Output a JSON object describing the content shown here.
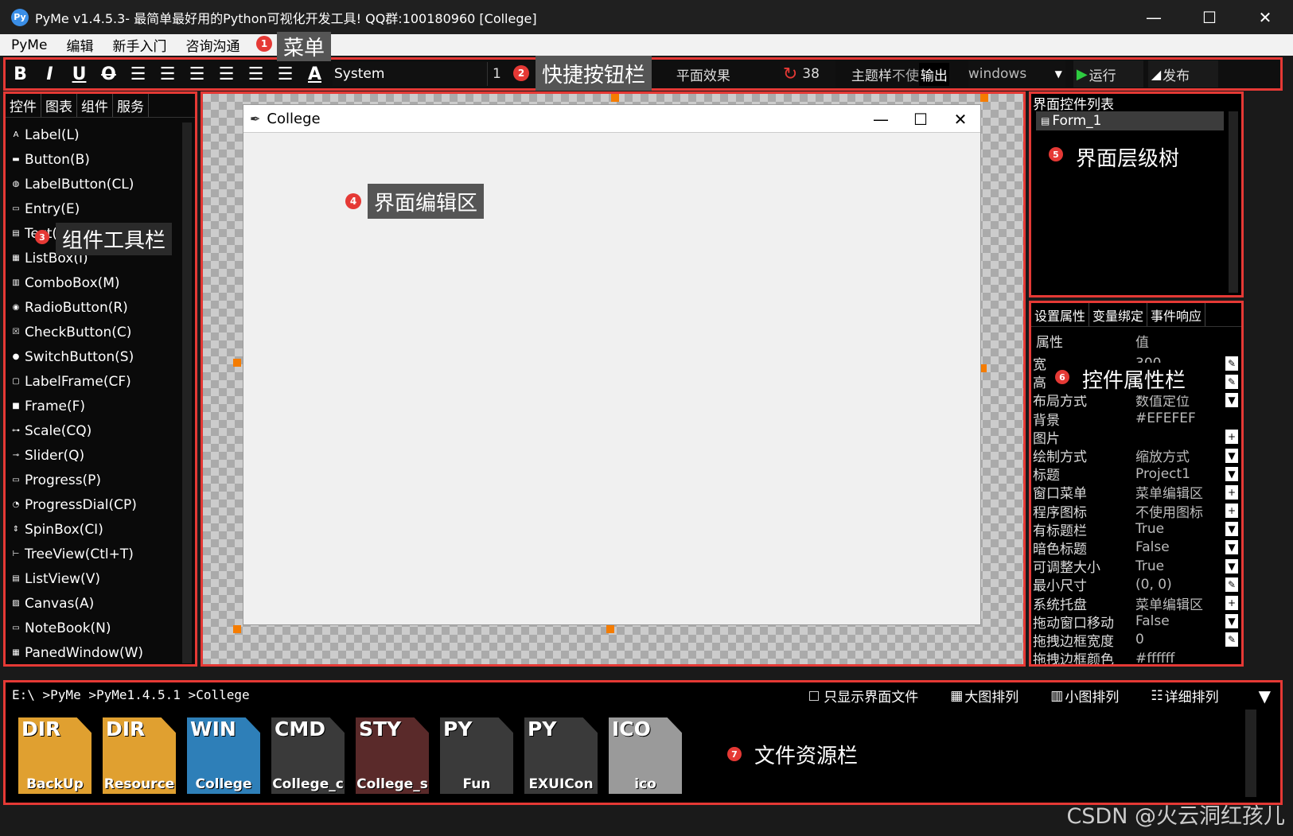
{
  "window": {
    "title": "PyMe v1.4.5.3- 最简单最好用的Python可视化开发工具! QQ群:100180960    [College]",
    "logo_text": "Py"
  },
  "menu": [
    "PyMe",
    "编辑",
    "新手入门",
    "咨询沟通"
  ],
  "callouts": {
    "c1": {
      "num": "1",
      "label": "菜单"
    },
    "c2": {
      "num": "2",
      "label": "快捷按钮栏"
    },
    "c3": {
      "num": "3",
      "label": "组件工具栏"
    },
    "c4": {
      "num": "4",
      "label": "界面编辑区"
    },
    "c5": {
      "num": "5",
      "label": "界面层级树"
    },
    "c6": {
      "num": "6",
      "label": "控件属性栏"
    },
    "c7": {
      "num": "7",
      "label": "文件资源栏"
    }
  },
  "toolbar": {
    "font_name": "System",
    "font_size": "1",
    "effect": "平面效果",
    "size_value": "38",
    "theme_label": "主题样",
    "theme_value": "不使",
    "output_label": "输出",
    "platform": "windows",
    "run_label": "运行",
    "publish_label": "发布"
  },
  "left_tabs": [
    "控件",
    "图表",
    "组件",
    "服务"
  ],
  "widgets": [
    "Label(L)",
    "Button(B)",
    "LabelButton(CL)",
    "Entry(E)",
    "Text(T)",
    "ListBox(I)",
    "ComboBox(M)",
    "RadioButton(R)",
    "CheckButton(C)",
    "SwitchButton(S)",
    "LabelFrame(CF)",
    "Frame(F)",
    "Scale(CQ)",
    "Slider(Q)",
    "Progress(P)",
    "ProgressDial(CP)",
    "SpinBox(CI)",
    "TreeView(Ctl+T)",
    "ListView(V)",
    "Canvas(A)",
    "NoteBook(N)",
    "PanedWindow(W)"
  ],
  "form": {
    "title": "College"
  },
  "tree": {
    "header": "界面控件列表",
    "root": "Form_1"
  },
  "prop_tabs": [
    "设置属性",
    "变量绑定",
    "事件响应"
  ],
  "prop_head": {
    "key": "属性",
    "value": "值"
  },
  "props": [
    {
      "key": "宽",
      "value": "300",
      "btn": "✎"
    },
    {
      "key": "高",
      "value": "",
      "btn": "✎"
    },
    {
      "key": "布局方式",
      "value": "数值定位",
      "btn": "▼"
    },
    {
      "key": "背景",
      "value": "#EFEFEF",
      "btn": ""
    },
    {
      "key": "图片",
      "value": "",
      "btn": "+"
    },
    {
      "key": "绘制方式",
      "value": "缩放方式",
      "btn": "▼"
    },
    {
      "key": "标题",
      "value": "Project1",
      "btn": "▼"
    },
    {
      "key": "窗口菜单",
      "value": "菜单编辑区",
      "btn": "+"
    },
    {
      "key": "程序图标",
      "value": "不使用图标",
      "btn": "+"
    },
    {
      "key": "有标题栏",
      "value": "True",
      "btn": "▼"
    },
    {
      "key": "暗色标题",
      "value": "False",
      "btn": "▼"
    },
    {
      "key": "可调整大小",
      "value": "True",
      "btn": "▼"
    },
    {
      "key": "最小尺寸",
      "value": "(0, 0)",
      "btn": "✎"
    },
    {
      "key": "系统托盘",
      "value": "菜单编辑区",
      "btn": "+"
    },
    {
      "key": "拖动窗口移动",
      "value": "False",
      "btn": "▼"
    },
    {
      "key": "拖拽边框宽度",
      "value": "0",
      "btn": "✎"
    },
    {
      "key": "拖拽边框颜色",
      "value": "#ffffff",
      "btn": ""
    }
  ],
  "files_panel": {
    "path": "E:\\ >PyMe >PyMe1.4.5.1 >College",
    "only_ui": "只显示界面文件",
    "big_icons": "大图排列",
    "small_icons": "小图排列",
    "details": "详细排列"
  },
  "files": [
    {
      "tag": "DIR",
      "name": "BackUp",
      "bg": "#e0a030"
    },
    {
      "tag": "DIR",
      "name": "Resource",
      "bg": "#e0a030"
    },
    {
      "tag": "WIN",
      "name": "College",
      "bg": "#2e7fb8"
    },
    {
      "tag": "CMD",
      "name": "College_c",
      "bg": "#3a3a3a"
    },
    {
      "tag": "STY",
      "name": "College_s",
      "bg": "#5a2a2a"
    },
    {
      "tag": "PY",
      "name": "Fun",
      "bg": "#3a3a3a"
    },
    {
      "tag": "PY",
      "name": "EXUICon",
      "bg": "#3a3a3a"
    },
    {
      "tag": "ICO",
      "name": "ico",
      "bg": "#9a9a9a"
    }
  ],
  "watermark": "CSDN @火云洞红孩儿"
}
